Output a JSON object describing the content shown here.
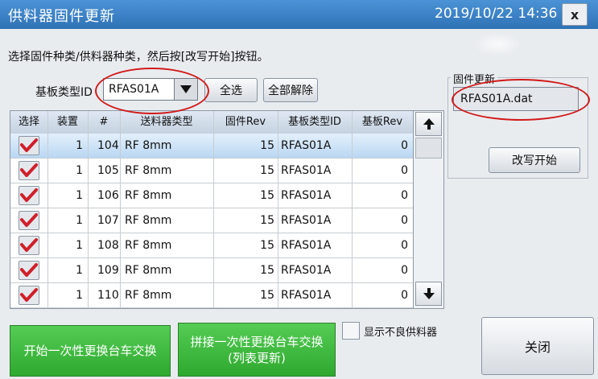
{
  "window": {
    "title": "供料器固件更新",
    "datetime": "2019/10/22 14:36",
    "close_label": "x"
  },
  "instruction": "选择固件种类/供料器种类，然后按[改写开始]按钮。",
  "board_type": {
    "label": "基板类型ID",
    "selected": "RFAS01A"
  },
  "buttons": {
    "select_all": "全选",
    "deselect_all": "全部解除",
    "rewrite_start": "改写开始",
    "start_bulk_exchange": "开始一次性更换台车交换",
    "splice_bulk_exchange": "拼接一次性更换台车交换\n(列表更新)",
    "close": "关闭"
  },
  "firmware_update": {
    "label": "固件更新",
    "file": "RFAS01A.dat"
  },
  "table": {
    "columns": [
      "选择",
      "装置",
      "#",
      "送料器类型",
      "固件Rev",
      "基板类型ID",
      "基板Rev"
    ],
    "rows": [
      {
        "checked": true,
        "device": "1",
        "num": "104",
        "feeder_type": "RF 8mm",
        "fw_rev": "15",
        "board_id": "RFAS01A",
        "board_rev": "0",
        "selected": true
      },
      {
        "checked": true,
        "device": "1",
        "num": "105",
        "feeder_type": "RF 8mm",
        "fw_rev": "15",
        "board_id": "RFAS01A",
        "board_rev": "0",
        "selected": false
      },
      {
        "checked": true,
        "device": "1",
        "num": "106",
        "feeder_type": "RF 8mm",
        "fw_rev": "15",
        "board_id": "RFAS01A",
        "board_rev": "0",
        "selected": false
      },
      {
        "checked": true,
        "device": "1",
        "num": "107",
        "feeder_type": "RF 8mm",
        "fw_rev": "15",
        "board_id": "RFAS01A",
        "board_rev": "0",
        "selected": false
      },
      {
        "checked": true,
        "device": "1",
        "num": "108",
        "feeder_type": "RF 8mm",
        "fw_rev": "15",
        "board_id": "RFAS01A",
        "board_rev": "0",
        "selected": false
      },
      {
        "checked": true,
        "device": "1",
        "num": "109",
        "feeder_type": "RF 8mm",
        "fw_rev": "15",
        "board_id": "RFAS01A",
        "board_rev": "0",
        "selected": false
      },
      {
        "checked": true,
        "device": "1",
        "num": "110",
        "feeder_type": "RF 8mm",
        "fw_rev": "15",
        "board_id": "RFAS01A",
        "board_rev": "0",
        "selected": false
      }
    ]
  },
  "show_bad_feeders": {
    "label": "显示不良供料器",
    "checked": false
  },
  "colors": {
    "titlebar": "#2f72b6",
    "checkmark": "#d01f2a",
    "green_button": "#2ea92e",
    "annotation": "#d21a1a"
  },
  "icons": {
    "dropdown": "triangle-down-icon",
    "scroll_up": "arrow-up-icon",
    "scroll_down": "arrow-down-icon",
    "check": "checkmark-icon"
  }
}
